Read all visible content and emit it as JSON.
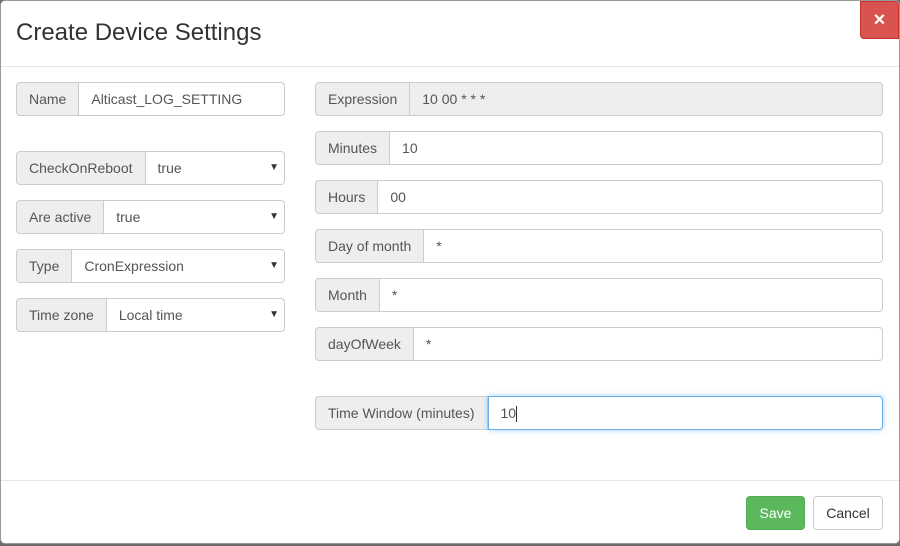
{
  "modal": {
    "title": "Create Device Settings",
    "close_label": "×"
  },
  "left": {
    "name": {
      "label": "Name",
      "value": "Alticast_LOG_SETTING"
    },
    "check_on_reboot": {
      "label": "CheckOnReboot",
      "value": "true"
    },
    "are_active": {
      "label": "Are active",
      "value": "true"
    },
    "type": {
      "label": "Type",
      "value": "CronExpression"
    },
    "time_zone": {
      "label": "Time zone",
      "value": "Local time"
    }
  },
  "right": {
    "expression": {
      "label": "Expression",
      "value": "10 00 * * *"
    },
    "minutes": {
      "label": "Minutes",
      "value": "10"
    },
    "hours": {
      "label": "Hours",
      "value": "00"
    },
    "day_of_month": {
      "label": "Day of month",
      "value": "*"
    },
    "month": {
      "label": "Month",
      "value": "*"
    },
    "day_of_week": {
      "label": "dayOfWeek",
      "value": "*"
    },
    "time_window": {
      "label": "Time Window (minutes)",
      "value": "10"
    }
  },
  "footer": {
    "save_label": "Save",
    "cancel_label": "Cancel"
  },
  "icons": {
    "dropdown": "chevron-down-icon",
    "close": "close-icon"
  },
  "colors": {
    "save": "#5cb85c",
    "close": "#d9534f",
    "focus": "#66afe9",
    "addon_bg": "#eeeeee"
  }
}
